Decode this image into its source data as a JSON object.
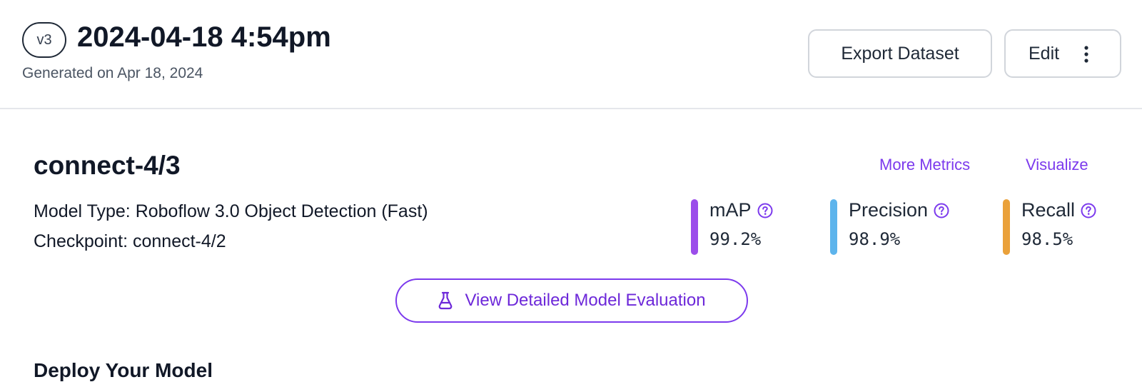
{
  "header": {
    "version_badge": "v3",
    "version_title": "2024-04-18 4:54pm",
    "generated": "Generated on Apr 18, 2024",
    "export_label": "Export Dataset",
    "edit_label": "Edit"
  },
  "model": {
    "name": "connect-4/3",
    "more_metrics": "More Metrics",
    "visualize": "Visualize",
    "model_type_key": "Model Type:",
    "model_type_value": "Roboflow 3.0 Object Detection (Fast)",
    "checkpoint_key": "Checkpoint:",
    "checkpoint_value": "connect-4/2",
    "metrics": [
      {
        "label": "mAP",
        "value": "99.2%",
        "color": "#9b4dea"
      },
      {
        "label": "Precision",
        "value": "98.9%",
        "color": "#5db4ec"
      },
      {
        "label": "Recall",
        "value": "98.5%",
        "color": "#eaa13a"
      }
    ],
    "eval_button": "View Detailed Model Evaluation"
  },
  "deploy": {
    "title": "Deploy Your Model"
  },
  "icons": {
    "help": "question-circle-icon",
    "kebab": "more-vertical-icon",
    "flask": "flask-icon"
  },
  "colors": {
    "accent": "#7c3aed"
  }
}
